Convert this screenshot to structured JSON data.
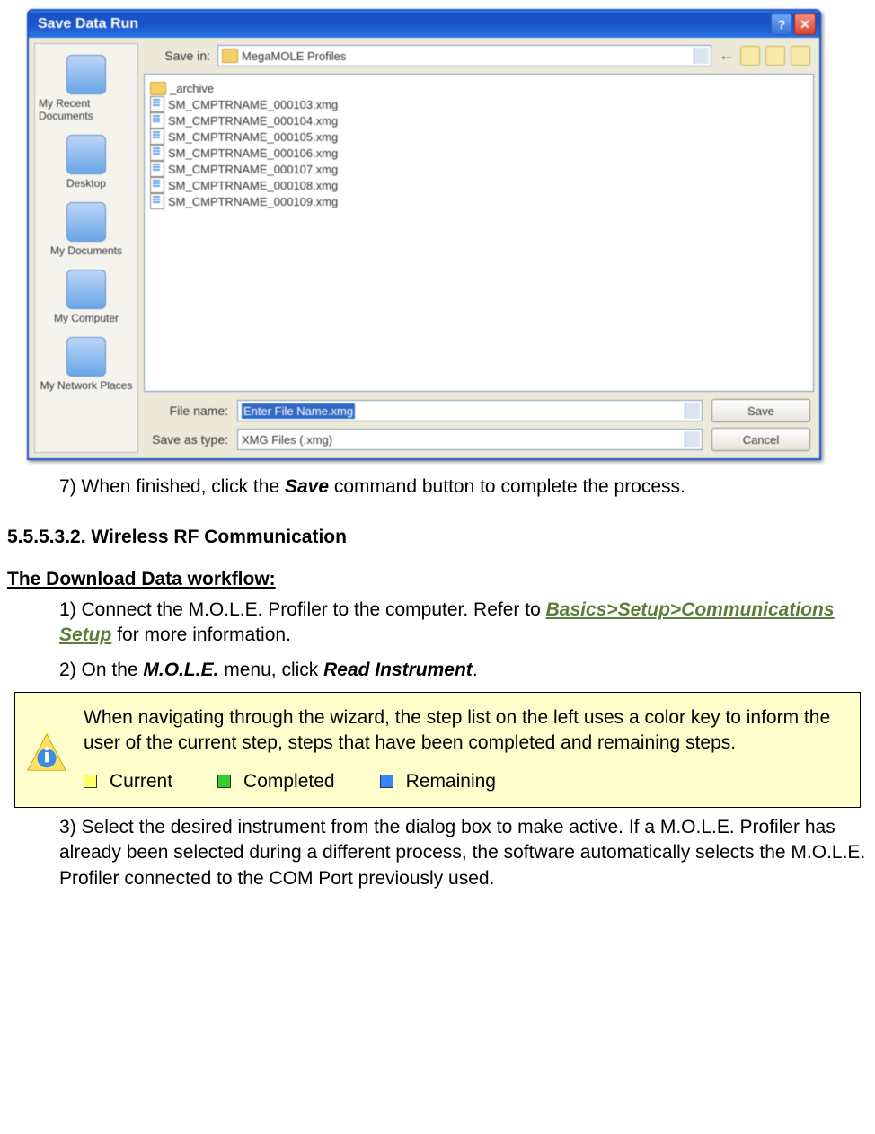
{
  "dialog": {
    "title": "Save Data Run",
    "save_in_label": "Save in:",
    "save_in_value": "MegaMOLE Profiles",
    "places": [
      "My Recent Documents",
      "Desktop",
      "My Documents",
      "My Computer",
      "My Network Places"
    ],
    "files": {
      "folder": "_archive",
      "items": [
        "SM_CMPTRNAME_000103.xmg",
        "SM_CMPTRNAME_000104.xmg",
        "SM_CMPTRNAME_000105.xmg",
        "SM_CMPTRNAME_000106.xmg",
        "SM_CMPTRNAME_000107.xmg",
        "SM_CMPTRNAME_000108.xmg",
        "SM_CMPTRNAME_000109.xmg"
      ]
    },
    "file_name_label": "File name:",
    "file_name_value": "Enter File Name.xmg",
    "type_label": "Save as type:",
    "type_value": "XMG Files (.xmg)",
    "save_btn": "Save",
    "cancel_btn": "Cancel"
  },
  "doc": {
    "step7": "When finished, click the ",
    "step7_bold": "Save",
    "step7_tail": " command button to complete the process.",
    "section_num": "5.5.5.3.2. Wireless RF Communication",
    "workflow_title": "The Download Data workflow:",
    "step1_a": "Connect the M.O.L.E. Profiler to the computer. Refer to ",
    "step1_link": "Basics>Setup>Communications Setup",
    "step1_b": " for more information.",
    "step2_a": "On the ",
    "step2_b": "M.O.L.E.",
    "step2_c": " menu, click ",
    "step2_d": "Read Instrument",
    "step2_e": ".",
    "note_text": "When navigating through the wizard, the step list on the left uses a color key to inform the user of the current step, steps that have been completed and remaining steps.",
    "legend": {
      "current": "Current",
      "completed": "Completed",
      "remaining": "Remaining"
    },
    "step3": "Select the desired instrument from the dialog box to make active. If a M.O.L.E. Profiler has already been selected during a different process, the software automatically selects the M.O.L.E. Profiler connected to the COM Port previously used."
  }
}
